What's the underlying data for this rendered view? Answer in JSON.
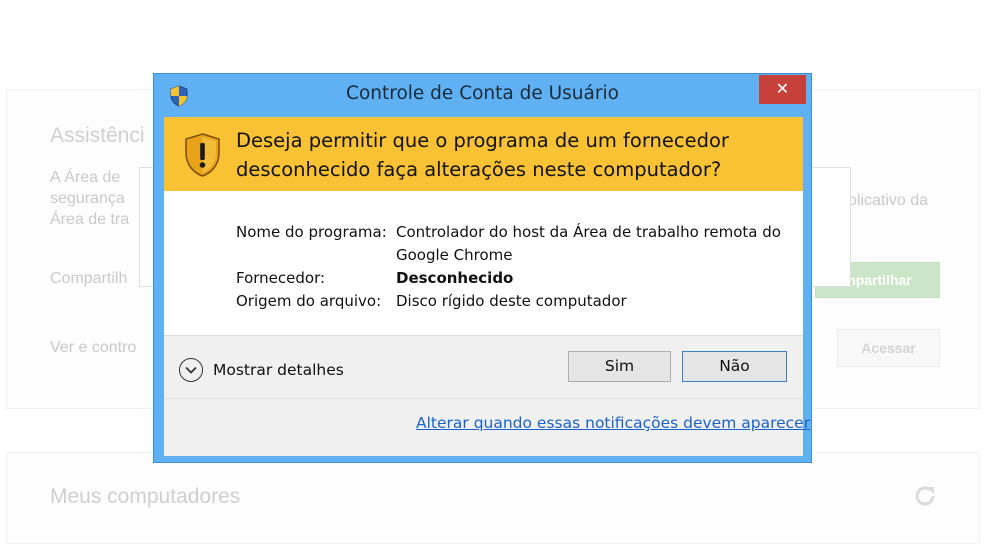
{
  "background": {
    "assistance_title": "Assistênci",
    "assistance_desc": [
      "A Área de",
      "segurança",
      "Área de tra"
    ],
    "assistance_right_text": "plicativo da",
    "share_label": "Compartilh",
    "share_button": "mpartilhar",
    "view_label": "Ver e contro",
    "access_button": "Acessar",
    "my_computers_title": "Meus computadores"
  },
  "dialog": {
    "title": "Controle de Conta de Usuário",
    "close_label": "✕",
    "question": "Deseja permitir que o programa de um fornecedor desconhecido faça alterações neste computador?",
    "program_label": "Nome do programa:",
    "program_value": "Controlador do host da Área de trabalho remota do Google Chrome",
    "publisher_label": "Fornecedor:",
    "publisher_value": "Desconhecido",
    "origin_label": "Origem do arquivo:",
    "origin_value": "Disco rígido deste computador",
    "show_details": "Mostrar detalhes",
    "yes_button": "Sim",
    "no_button": "Não",
    "settings_link": "Alterar quando essas notificações devem aparecer"
  },
  "colors": {
    "title_bar": "#5fb1f3",
    "warning_band": "#f9c235",
    "close_button": "#c7413b",
    "link": "#1b62c5"
  },
  "icons": [
    "uac-shield-icon",
    "warning-shield-icon",
    "close-icon",
    "chevron-down-icon",
    "refresh-icon"
  ]
}
